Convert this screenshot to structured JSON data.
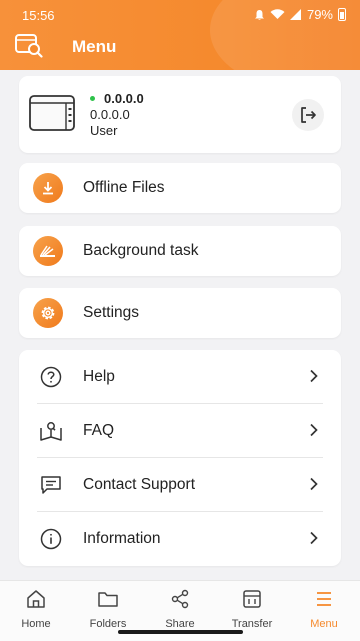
{
  "status_bar": {
    "time": "15:56",
    "battery": "79%",
    "icons": [
      "notification-icon",
      "wifi-icon",
      "signal-icon",
      "battery-icon"
    ]
  },
  "header": {
    "title": "Menu",
    "icon": "nas-search-icon"
  },
  "device": {
    "name": "0.0.0.0",
    "address": "0.0.0.0",
    "user": "User",
    "status_color": "#2ec24a",
    "logout_icon": "logout-icon"
  },
  "menu": [
    {
      "label": "Offline Files",
      "icon": "download-icon"
    },
    {
      "label": "Background task",
      "icon": "background-task-icon"
    },
    {
      "label": "Settings",
      "icon": "gear-icon"
    }
  ],
  "support": [
    {
      "label": "Help",
      "icon": "help-icon"
    },
    {
      "label": "FAQ",
      "icon": "faq-book-icon"
    },
    {
      "label": "Contact Support",
      "icon": "chat-icon"
    },
    {
      "label": "Information",
      "icon": "info-icon"
    }
  ],
  "tabs": [
    {
      "label": "Home",
      "icon": "home-icon"
    },
    {
      "label": "Folders",
      "icon": "folder-icon"
    },
    {
      "label": "Share",
      "icon": "share-icon"
    },
    {
      "label": "Transfer",
      "icon": "transfer-icon"
    },
    {
      "label": "Menu",
      "icon": "menu-icon",
      "active": true
    }
  ],
  "colors": {
    "accent": "#f58a2e",
    "background": "#f2f2f4",
    "online": "#2ec24a"
  }
}
